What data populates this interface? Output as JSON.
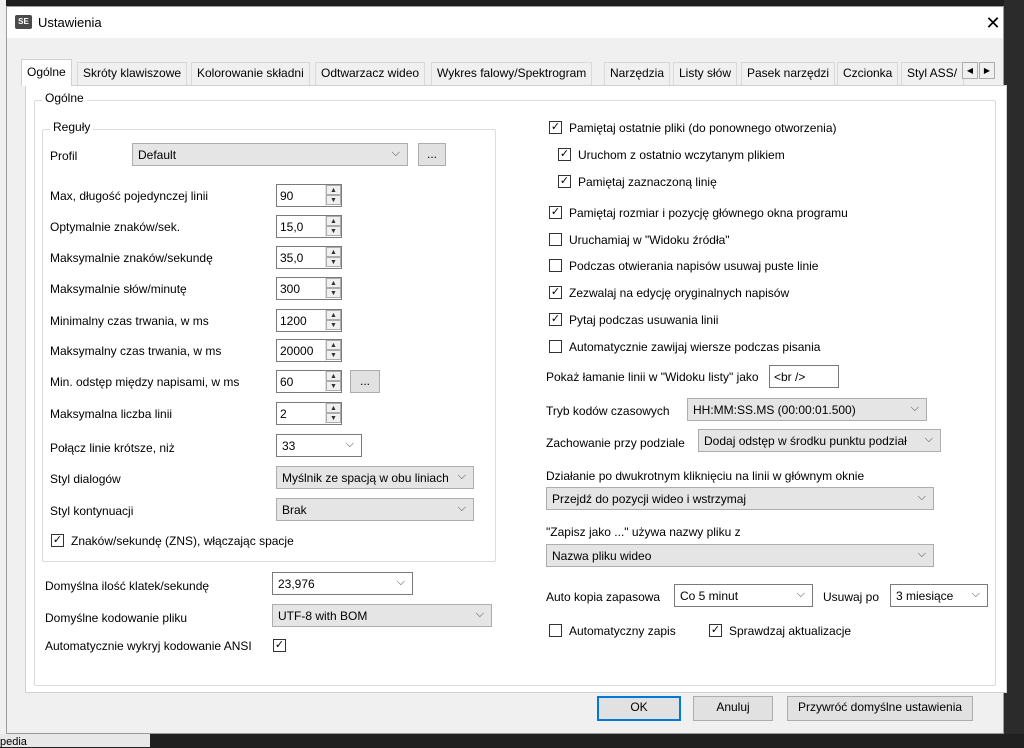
{
  "window": {
    "title": "Ustawienia",
    "icon_text": "SE",
    "close_glyph": "✕"
  },
  "background": {
    "fragment_text": "pedia"
  },
  "tabs": [
    "Ogólne",
    "Skróty klawiszowe",
    "Kolorowanie składni",
    "Odtwarzacz wideo",
    "Wykres falowy/Spektrogram",
    "Narzędzia",
    "Listy słów",
    "Pasek narzędzi",
    "Czcionka",
    "Styl ASS/"
  ],
  "tab_scroll": {
    "left": "◀",
    "right": "▶"
  },
  "general_group": {
    "label": "Ogólne"
  },
  "rules": {
    "label": "Reguły",
    "profile_label": "Profil",
    "profile_value": "Default",
    "ellipsis": "...",
    "rows": [
      {
        "label": "Max, długość pojedynczej linii",
        "value": "90"
      },
      {
        "label": "Optymalnie znaków/sek.",
        "value": "15,0"
      },
      {
        "label": "Maksymalnie znaków/sekundę",
        "value": "35,0"
      },
      {
        "label": "Maksymalnie słów/minutę",
        "value": "300"
      },
      {
        "label": "Minimalny czas trwania, w ms",
        "value": "1200"
      },
      {
        "label": "Maksymalny czas trwania, w ms",
        "value": "20000"
      },
      {
        "label": "Min. odstęp między napisami, w ms",
        "value": "60"
      },
      {
        "label": "Maksymalna liczba linii",
        "value": "2"
      }
    ],
    "merge_label": "Połącz linie krótsze, niż",
    "merge_value": "33",
    "dialog_style_label": "Styl dialogów",
    "dialog_style_value": "Myślnik ze spacją w obu liniach",
    "continuation_label": "Styl kontynuacji",
    "continuation_value": "Brak",
    "cps_spaces_label": "Znaków/sekundę (ZNS), włączając spacje",
    "cps_spaces_checked": true
  },
  "framerate_label": "Domyślna ilość klatek/sekundę",
  "framerate_value": "23,976",
  "encoding_label": "Domyślne kodowanie pliku",
  "encoding_value": "UTF-8 with BOM",
  "ansi_label": "Automatycznie wykryj kodowanie ANSI",
  "ansi_checked": true,
  "right": {
    "checks": [
      {
        "label": "Pamiętaj ostatnie pliki (do ponownego otworzenia)",
        "checked": true
      },
      {
        "label": "Uruchom z ostatnio wczytanym plikiem",
        "checked": true
      },
      {
        "label": "Pamiętaj zaznaczoną linię",
        "checked": true
      },
      {
        "label": "Pamiętaj rozmiar i pozycję głównego okna programu",
        "checked": true
      },
      {
        "label": "Uruchamiaj w \"Widoku źródła\"",
        "checked": false
      },
      {
        "label": "Podczas otwierania napisów usuwaj puste linie",
        "checked": false
      },
      {
        "label": "Zezwalaj na edycję oryginalnych napisów",
        "checked": true
      },
      {
        "label": "Pytaj podczas usuwania linii",
        "checked": true
      },
      {
        "label": "Automatycznie zawijaj wiersze podczas pisania",
        "checked": false
      }
    ],
    "line_break_label": "Pokaż łamanie linii w \"Widoku listy\" jako",
    "line_break_value": "<br />",
    "timecode_label": "Tryb kodów czasowych",
    "timecode_value": "HH:MM:SS.MS (00:00:01.500)",
    "split_label": "Zachowanie przy podziale",
    "split_value": "Dodaj odstęp w środku punktu podział",
    "dblclick_label": "Działanie po dwukrotnym kliknięciu na linii w głównym oknie",
    "dblclick_value": "Przejdź do pozycji wideo i wstrzymaj",
    "saveas_label": "\"Zapisz jako ...\" używa nazwy pliku z",
    "saveas_value": "Nazwa pliku wideo",
    "autobackup_label": "Auto kopia zapasowa",
    "autobackup_value": "Co 5 minut",
    "delete_after_label": "Usuwaj po",
    "delete_after_value": "3 miesiące",
    "autosave_label": "Automatyczny zapis",
    "autosave_checked": false,
    "check_updates_label": "Sprawdzaj aktualizacje",
    "check_updates_checked": true
  },
  "buttons": {
    "ok": "OK",
    "cancel": "Anuluj",
    "restore": "Przywróć domyślne ustawienia"
  },
  "glyphs": {
    "check": "✓",
    "down": "⌵",
    "up": "▲",
    "dn": "▼"
  }
}
